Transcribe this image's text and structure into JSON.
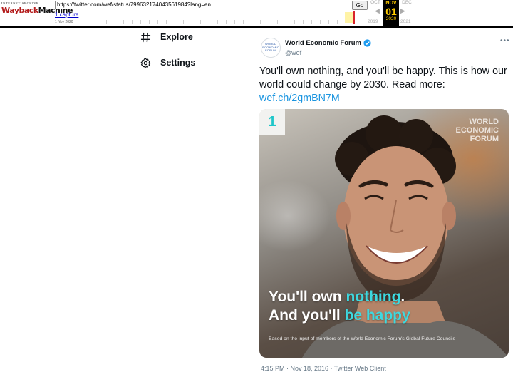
{
  "wayback": {
    "logo_top": "INTERNET ARCHIVE",
    "logo_way": "Wayback",
    "logo_machine": "Machine",
    "url": "https://twitter.com/wef/status/799632174043561984?lang=en",
    "go_label": "Go",
    "captures": "1 capture",
    "capture_date": "1 Nov 2020",
    "prev_month": "OCT",
    "current_month": "NOV",
    "current_day": "01",
    "current_year": "2020",
    "next_month": "DEC",
    "prev_year": "2019",
    "next_year": "2021"
  },
  "nav": {
    "explore": "Explore",
    "settings": "Settings"
  },
  "tweet": {
    "avatar_lines": [
      "WORLD",
      "ECONOMIC",
      "FORUM"
    ],
    "author_name": "World Economic Forum",
    "author_handle": "@wef",
    "more": "•••",
    "text": "You'll own nothing, and you'll be happy. This is how our world could change by 2030. Read more:",
    "link": "wef.ch/2gmBN7M",
    "media": {
      "number": "1",
      "brand": "WORLD ECONOMIC FORUM",
      "headline_1_plain": "You'll own ",
      "headline_1_highlight": "nothing",
      "headline_1_end": ".",
      "headline_2_plain": "And you'll ",
      "headline_2_highlight": "be happy",
      "caption": "Based on the input of members of the World Economic Forum's Global Future Councils"
    },
    "meta": "4:15 PM · Nov 18, 2016 · Twitter Web Client"
  },
  "colors": {
    "link": "#1b95e0",
    "highlight": "#3dd9e0",
    "wayback_red": "#b31c1c",
    "wayback_gold": "#ffcc00"
  }
}
